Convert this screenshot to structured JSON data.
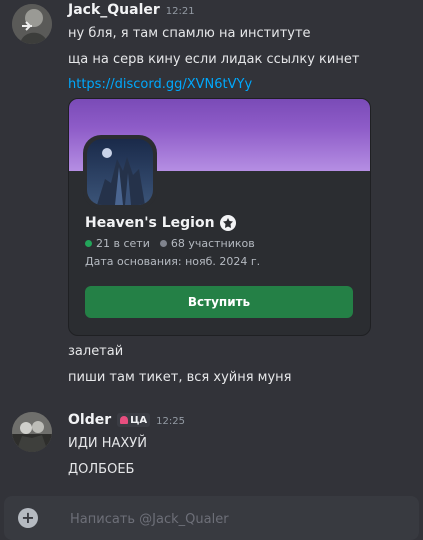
{
  "messages": [
    {
      "username": "Jack_Qualer",
      "timestamp": "12:21",
      "lines": [
        "ну бля, я там спамлю на институте",
        "ща на серв кину если лидак ссылку кинет"
      ],
      "link": "https://discord.gg/XVN6tVYy"
    },
    {
      "lines": [
        "залетай",
        "пиши там тикет, вся хуйня муня"
      ]
    },
    {
      "username": "Older",
      "role_tag": "ЦА",
      "timestamp": "12:25",
      "lines": [
        "ИДИ НАХУЙ",
        "ДОЛБОЕБ"
      ]
    }
  ],
  "invite": {
    "server_name": "Heaven's Legion",
    "online": "21 в сети",
    "members": "68 участников",
    "founded": "Дата основания: нояб. 2024 г.",
    "join_label": "Вступить",
    "online_color": "#23a55a",
    "members_color": "#80848e",
    "button_color": "#248046"
  },
  "composer": {
    "placeholder": "Написать @Jack_Qualer"
  }
}
